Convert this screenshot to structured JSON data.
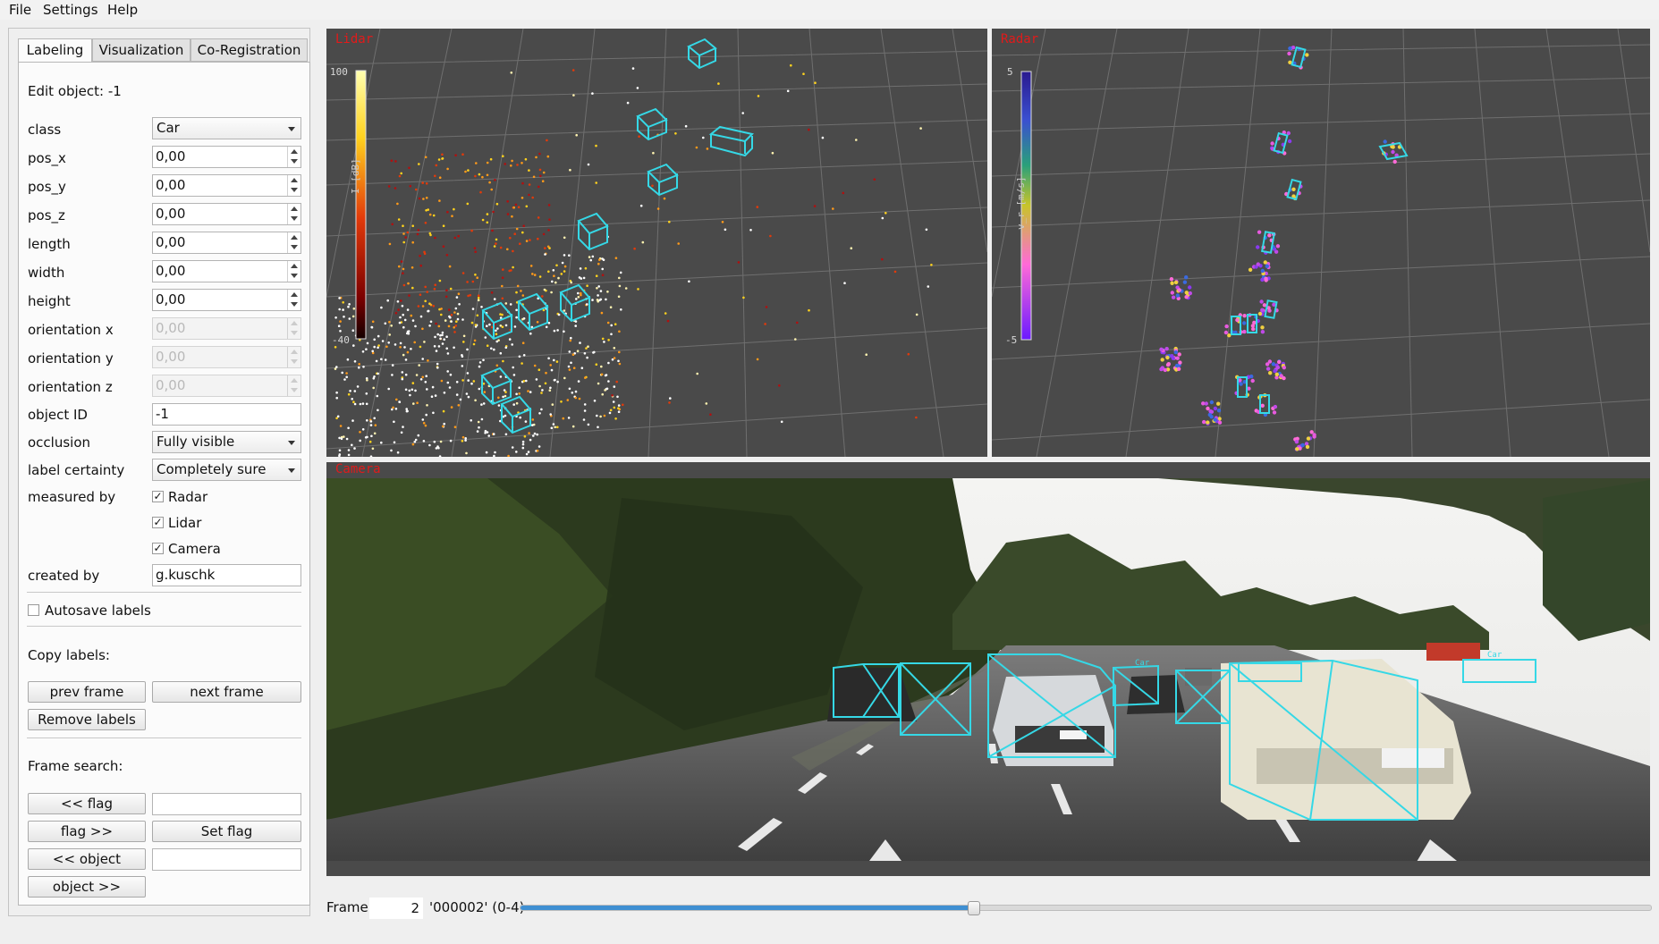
{
  "menu": [
    "File",
    "Settings",
    "Help"
  ],
  "tabs": [
    "Labeling",
    "Visualization",
    "Co-Registration"
  ],
  "edit_object": "Edit object: -1",
  "fields": {
    "class": {
      "label": "class",
      "value": "Car"
    },
    "pos_x": {
      "label": "pos_x",
      "value": "0,00"
    },
    "pos_y": {
      "label": "pos_y",
      "value": "0,00"
    },
    "pos_z": {
      "label": "pos_z",
      "value": "0,00"
    },
    "length": {
      "label": "length",
      "value": "0,00"
    },
    "width": {
      "label": "width",
      "value": "0,00"
    },
    "height": {
      "label": "height",
      "value": "0,00"
    },
    "orientation_x": {
      "label": "orientation x",
      "value": "0,00"
    },
    "orientation_y": {
      "label": "orientation y",
      "value": "0,00"
    },
    "orientation_z": {
      "label": "orientation z",
      "value": "0,00"
    },
    "object_id": {
      "label": "object ID",
      "value": "-1"
    },
    "occlusion": {
      "label": "occlusion",
      "value": "Fully visible"
    },
    "label_certainty": {
      "label": "label certainty",
      "value": "Completely sure"
    },
    "measured_by": {
      "label": "measured by",
      "options": [
        "Radar",
        "Lidar",
        "Camera"
      ],
      "checked": [
        true,
        true,
        true
      ]
    },
    "created_by": {
      "label": "created by",
      "value": "g.kuschk"
    }
  },
  "autosave": {
    "label": "Autosave labels",
    "checked": false
  },
  "copy_labels": {
    "title": "Copy labels:",
    "prev": "prev frame",
    "next": "next frame",
    "remove": "Remove labels"
  },
  "frame_search": {
    "title": "Frame search:",
    "prev_flag": "<< flag",
    "next_flag": "flag >>",
    "set_flag": "Set flag",
    "prev_object": "<< object",
    "next_object": "object >>"
  },
  "views": {
    "lidar": {
      "title": "Lidar",
      "scale_max": "100",
      "scale_min": "-40",
      "scale_label": "I [dB]"
    },
    "radar": {
      "title": "Radar",
      "scale_max": "5",
      "scale_min": "-5",
      "scale_label": "v_r [m/s]"
    },
    "camera": {
      "title": "Camera",
      "box_label": "Car"
    }
  },
  "frame": {
    "label": "Frame",
    "value": "2",
    "info": "'000002' (0-4)",
    "slider_position": 0.4
  },
  "colors": {
    "accent": "#35d8e6",
    "view_bg": "#4a4a4a",
    "title": "#e21a1a",
    "slider": "#3f8fd2"
  }
}
